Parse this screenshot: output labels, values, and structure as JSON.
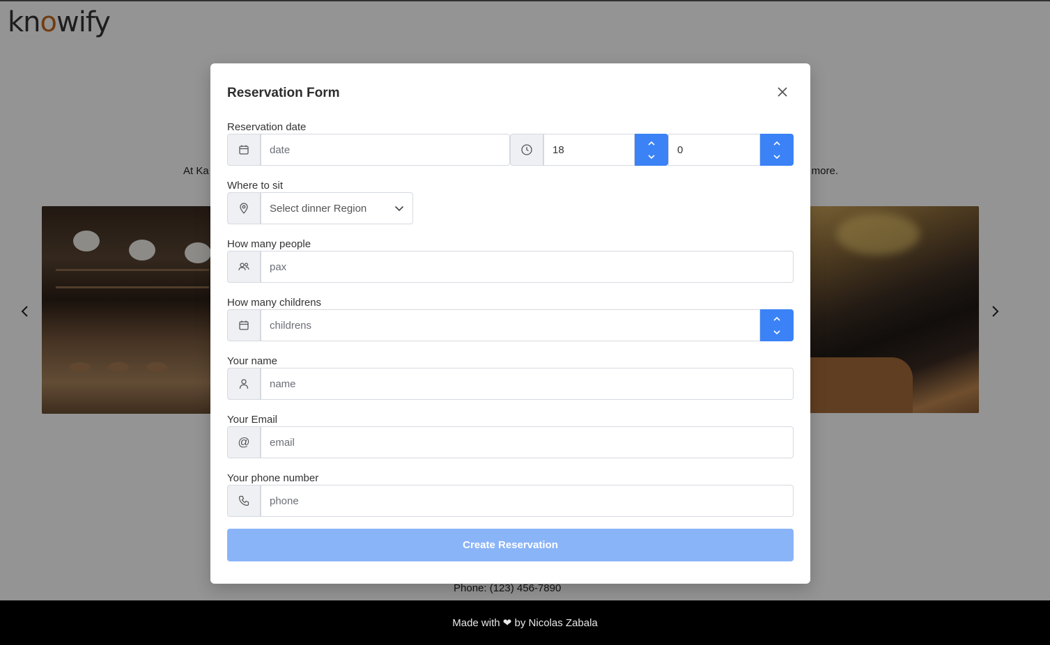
{
  "brand": {
    "logo": "knowify"
  },
  "page": {
    "intro_start": "At Ka",
    "intro_end": "more.",
    "contact_phone": "Phone: (123) 456-7890"
  },
  "footer": {
    "made_with": "Made with",
    "by": "by Nicolas Zabala"
  },
  "carousel": {
    "prev_icon": "chevron-left-icon",
    "next_icon": "chevron-right-icon"
  },
  "modal": {
    "title": "Reservation Form",
    "close_icon": "close-icon",
    "date": {
      "label": "Reservation date",
      "placeholder": "date",
      "hour_value": "18",
      "minute_value": "0"
    },
    "region": {
      "label": "Where to sit",
      "selected": "Select dinner Region"
    },
    "people": {
      "label": "How many people",
      "placeholder": "pax"
    },
    "children": {
      "label": "How many childrens",
      "placeholder": "childrens"
    },
    "name": {
      "label": "Your name",
      "placeholder": "name"
    },
    "email": {
      "label": "Your Email",
      "placeholder": "email"
    },
    "phone": {
      "label": "Your phone number",
      "placeholder": "phone"
    },
    "submit_label": "Create Reservation"
  },
  "colors": {
    "accent": "#3b82f6",
    "submit_disabled": "#8ab4f8",
    "overlay": "rgba(0,0,0,0.42)"
  }
}
